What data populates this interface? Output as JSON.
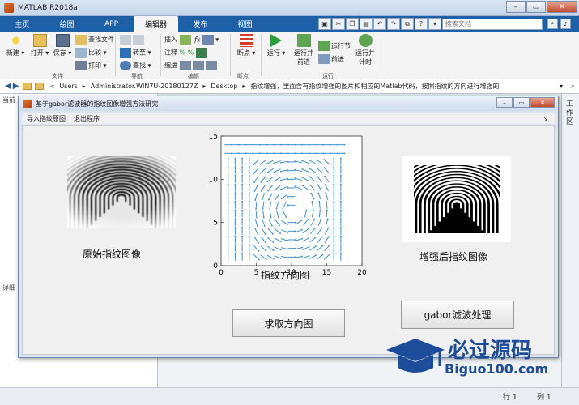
{
  "window": {
    "title": "MATLAB R2018a",
    "controls": [
      "–",
      "▭",
      "✕"
    ]
  },
  "ribbon_tabs": [
    "主页",
    "绘图",
    "APP",
    "编辑器",
    "发布",
    "视图"
  ],
  "active_tab": "编辑器",
  "search": {
    "placeholder": "搜索文档"
  },
  "ribbon": {
    "new": "新建",
    "open": "打开",
    "save": "保存",
    "find_file": "查找文件",
    "compare": "比较",
    "print": "打印",
    "file_section": "文件",
    "goto": "转至",
    "find": "查找",
    "nav_section": "导航",
    "insert": "插入",
    "comment": "注释",
    "indent": "缩进",
    "fx": "fx",
    "edit_section": "编辑",
    "breakpoint": "断点",
    "bp_section": "断点",
    "run": "运行",
    "run_advance": [
      "运行并",
      "前进"
    ],
    "run_section_btn": "运行节",
    "advance": "前进",
    "run_time": [
      "运行并",
      "计时"
    ],
    "run_section": "运行"
  },
  "address": {
    "segments": [
      "«",
      "Users",
      "▸",
      "Administrator.WIN7U-20180127Z",
      "▸",
      "Desktop",
      "▸",
      "指纹增强，里面含有指纹增强的图片和相应的Matlab代码，按照指纹的方向进行增强的"
    ]
  },
  "side": {
    "current_folder_label": "当前",
    "details_label": "详细",
    "workspace_label": "工作区"
  },
  "status": {
    "row": "行 1",
    "col": "列 1"
  },
  "figure": {
    "title": "基于gabor滤波器的指纹图像增强方法研究",
    "menu": [
      "导入指纹原图",
      "退出程序"
    ],
    "original_label": "原始指纹图像",
    "orientation_label": "指纹方向图",
    "enhanced_label": "增强后指纹图像",
    "orient_button": "求取方向图",
    "gabor_button": "gabor滤波处理"
  },
  "chart_data": {
    "type": "quiver",
    "xlim": [
      0,
      20
    ],
    "ylim": [
      0,
      15
    ],
    "xticks": [
      "0",
      "5",
      "10",
      "15",
      "20"
    ],
    "yticks": [
      "0",
      "5",
      "10",
      "15"
    ],
    "color": "#3a8fd0",
    "grid_x": [
      1,
      2,
      3,
      4,
      5,
      6,
      7,
      8,
      9,
      10,
      11,
      12,
      13,
      14,
      15,
      16,
      17
    ],
    "grid_y": [
      1,
      2,
      3,
      4,
      5,
      6,
      7,
      8,
      9,
      10,
      11,
      12,
      13,
      14
    ],
    "center": [
      10,
      6.5
    ],
    "missing": [
      [
        11,
        8
      ],
      [
        12,
        8
      ],
      [
        11,
        7
      ],
      [
        11,
        6
      ],
      [
        10,
        6
      ],
      [
        12,
        7
      ]
    ]
  },
  "watermark": {
    "cn": "必过源码",
    "en": "Biguo100.com"
  }
}
